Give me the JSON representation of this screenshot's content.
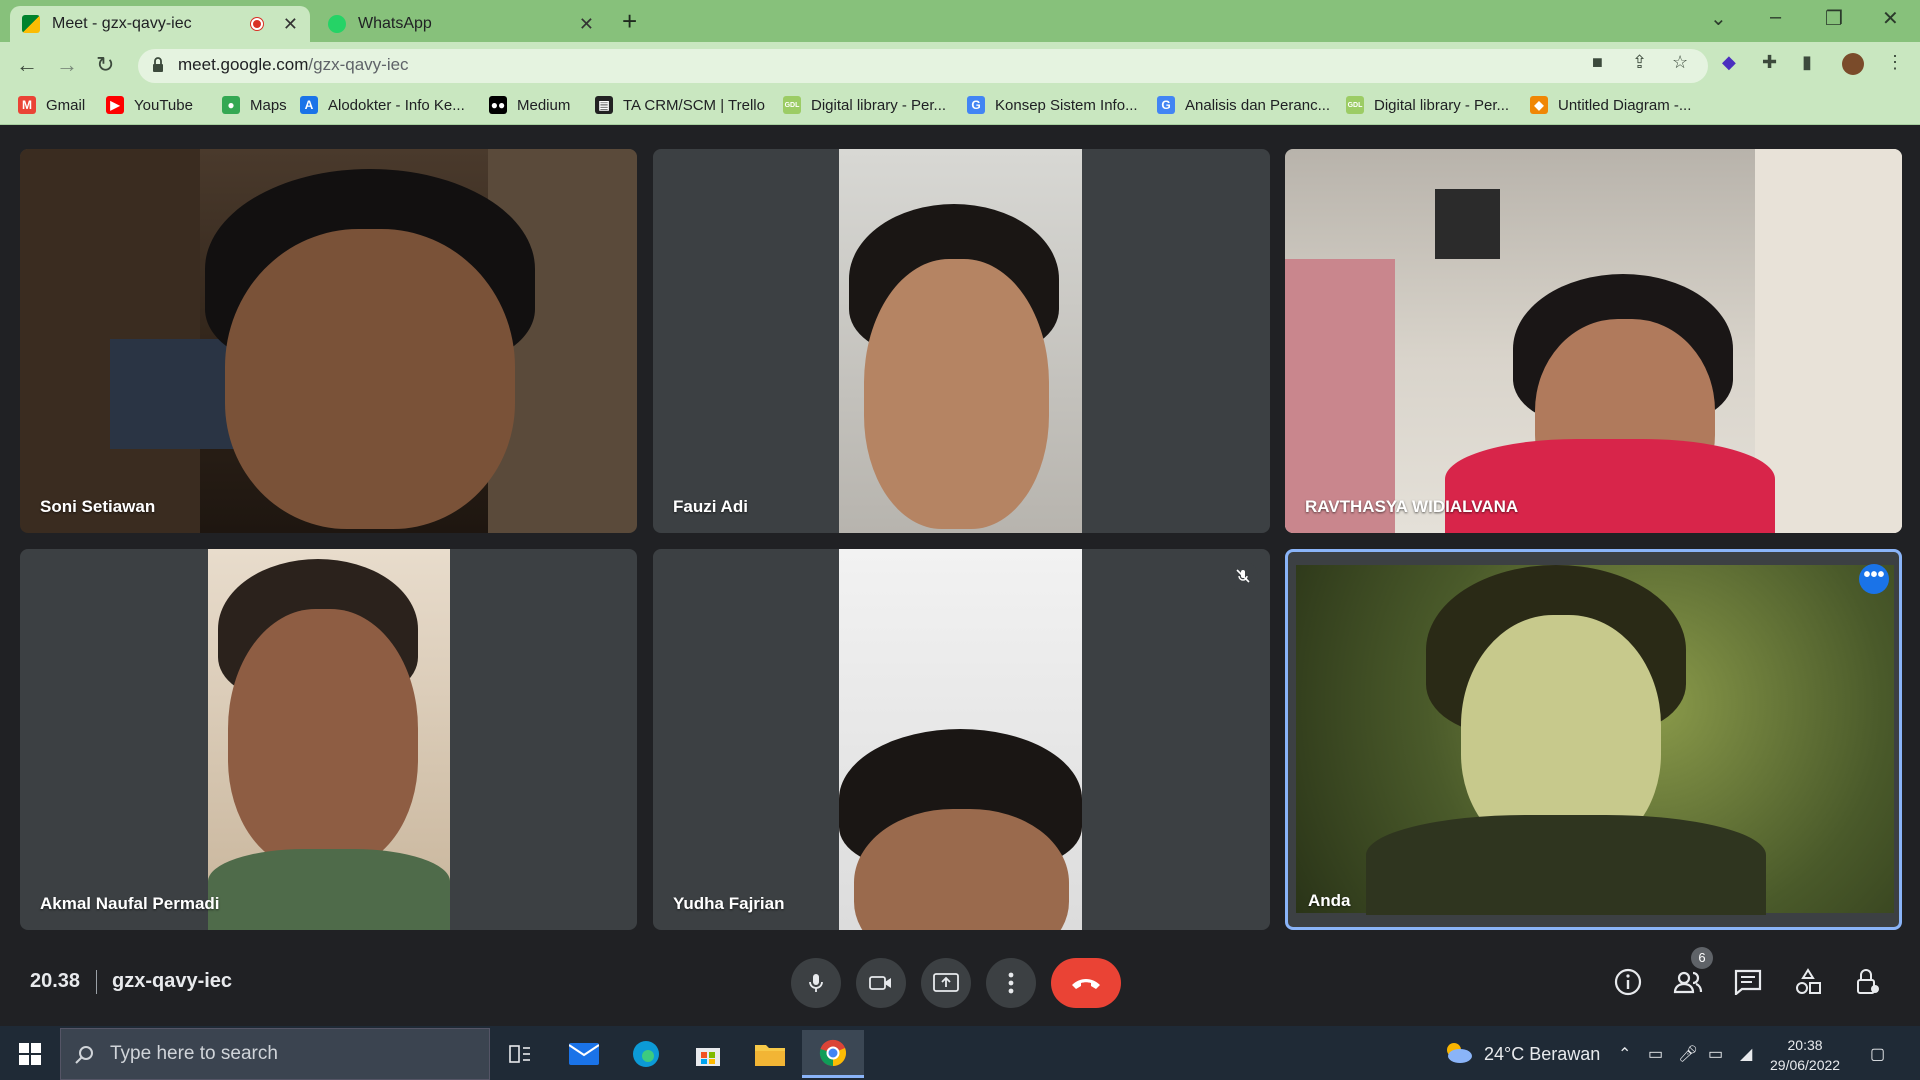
{
  "browser": {
    "tabs": [
      {
        "title": "Meet - gzx-qavy-iec",
        "active": true,
        "recording": true
      },
      {
        "title": "WhatsApp",
        "active": false
      }
    ],
    "url_host": "meet.google.com",
    "url_path": "/gzx-qavy-iec",
    "bookmarks": [
      {
        "label": "Gmail",
        "icon": "gmail-icon",
        "color": "#ea4335"
      },
      {
        "label": "YouTube",
        "icon": "youtube-icon",
        "color": "#ff0000"
      },
      {
        "label": "Maps",
        "icon": "maps-icon",
        "color": "#34a853"
      },
      {
        "label": "Alodokter - Info Ke...",
        "icon": "alodokter-icon",
        "color": "#1a73e8"
      },
      {
        "label": "Medium",
        "icon": "medium-icon",
        "color": "#000000"
      },
      {
        "label": "TA CRM/SCM | Trello",
        "icon": "trello-icon",
        "color": "#222222"
      },
      {
        "label": "Digital library - Per...",
        "icon": "gdl-icon",
        "color": "#9ccc65"
      },
      {
        "label": "Konsep Sistem Info...",
        "icon": "google-icon",
        "color": "#4285f4"
      },
      {
        "label": "Analisis dan Peranc...",
        "icon": "google-icon",
        "color": "#4285f4"
      },
      {
        "label": "Digital library - Per...",
        "icon": "gdl-icon",
        "color": "#9ccc65"
      },
      {
        "label": "Untitled Diagram -...",
        "icon": "drawio-icon",
        "color": "#f08705"
      }
    ]
  },
  "meet": {
    "participants": [
      {
        "name": "Soni Setiawan"
      },
      {
        "name": "Fauzi Adi"
      },
      {
        "name": "RAVTHASYA WIDIALVANA"
      },
      {
        "name": "Akmal Naufal Permadi"
      },
      {
        "name": "Yudha Fajrian",
        "muted": true
      },
      {
        "name": "Anda",
        "self": true
      }
    ],
    "time": "20.38",
    "meeting_code": "gzx-qavy-iec",
    "people_count": "6",
    "accent_color": "#8ab4f8",
    "end_call_color": "#ea4335"
  },
  "taskbar": {
    "search_placeholder": "Type here to search",
    "weather": "24°C  Berawan",
    "clock_time": "20:38",
    "clock_date": "29/06/2022"
  }
}
